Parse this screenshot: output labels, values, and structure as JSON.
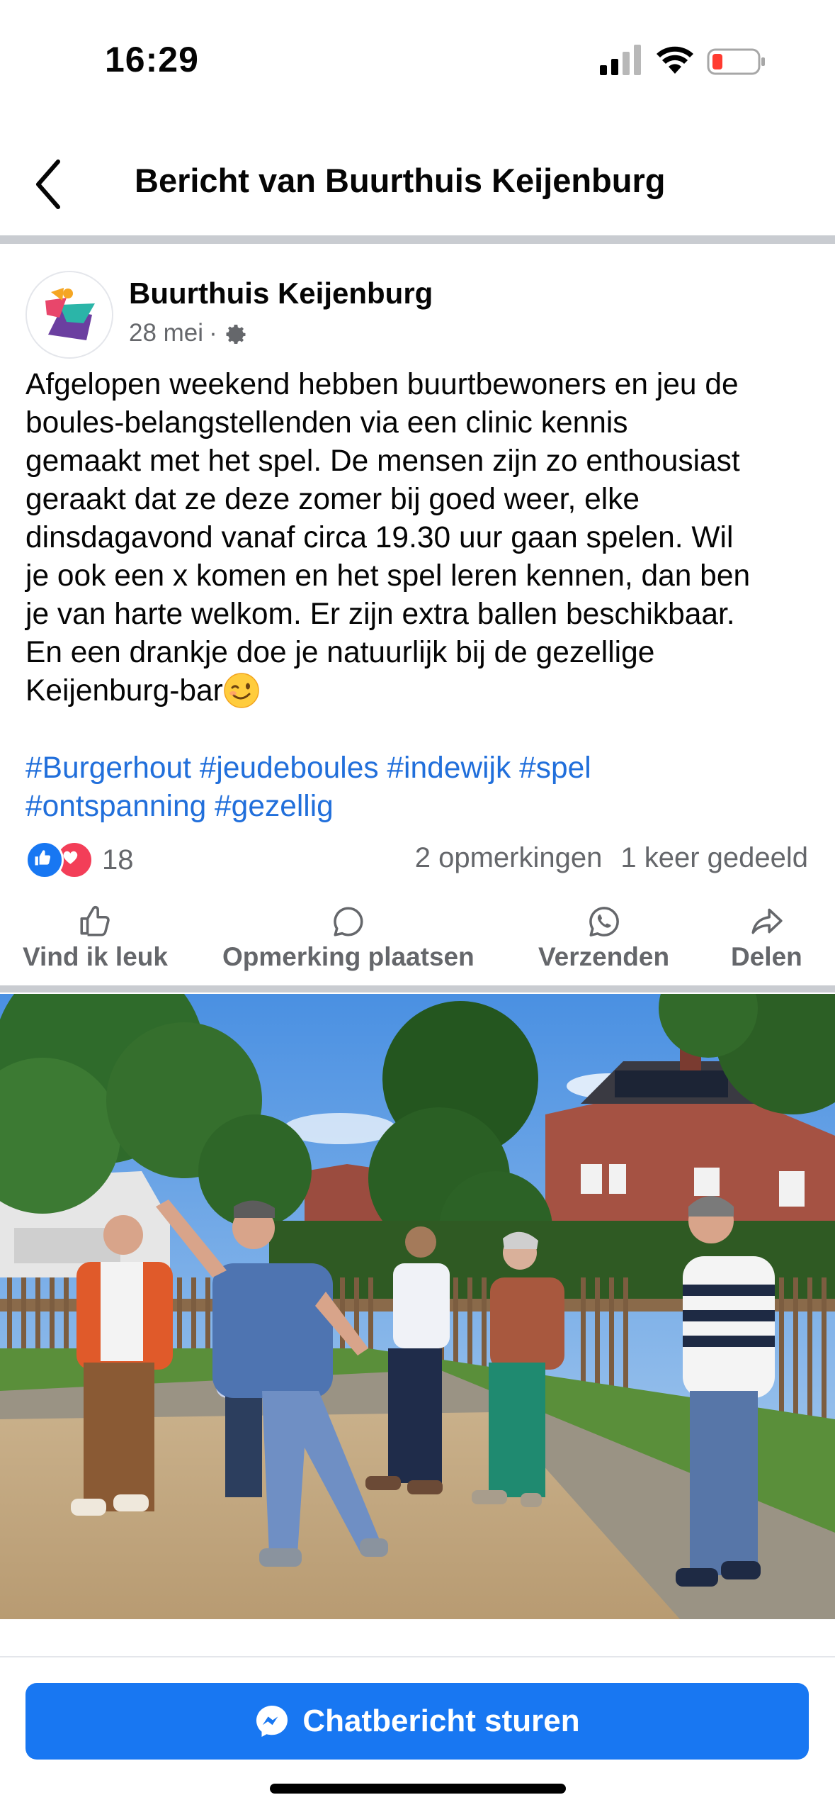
{
  "status_bar": {
    "time": "16:29",
    "icons": [
      "signal-icon",
      "wifi-icon",
      "battery-low-icon"
    ]
  },
  "header": {
    "title": "Bericht van Buurthuis Keijenburg",
    "back_icon": "chevron-left-icon"
  },
  "post": {
    "author": "Buurthuis Keijenburg",
    "date": "28 mei",
    "separator": "·",
    "privacy_icon": "gear-icon",
    "body_lines": [
      "Afgelopen weekend hebben buurtbewoners en jeu de",
      "boules-belangstellenden via een clinic kennis",
      "gemaakt met het spel. De mensen zijn zo enthousiast",
      "geraakt dat ze deze zomer bij goed weer, elke",
      "dinsdagavond vanaf circa 19.30 uur gaan spelen. Wil",
      "je ook een x komen en het spel leren kennen, dan ben",
      "je van harte welkom. Er zijn extra ballen beschikbaar.",
      "En een drankje doe je natuurlijk bij de gezellige",
      "Keijenburg-bar"
    ],
    "emoji": "winking-face-emoji",
    "hashtags_line1": [
      "#Burgerhout",
      "#jeudeboules",
      "#indewijk",
      "#spel"
    ],
    "hashtags_line2": [
      "#ontspanning",
      "#gezellig"
    ],
    "reaction_count": "18",
    "reaction_icons": [
      "like-reaction-icon",
      "love-reaction-icon"
    ],
    "comments": "2 opmerkingen",
    "shares": "1 keer gedeeld"
  },
  "actions": [
    {
      "label": "Vind ik leuk",
      "icon": "thumbs-up-icon"
    },
    {
      "label": "Opmerking plaatsen",
      "icon": "comment-icon"
    },
    {
      "label": "Verzenden",
      "icon": "whatsapp-icon"
    },
    {
      "label": "Delen",
      "icon": "share-icon"
    }
  ],
  "cta": {
    "label": "Chatbericht sturen",
    "icon": "messenger-icon"
  },
  "colors": {
    "brand_blue": "#1877f2",
    "hashtag_blue": "#216fdb",
    "secondary_text": "#65676b",
    "love_red": "#f33e58"
  }
}
